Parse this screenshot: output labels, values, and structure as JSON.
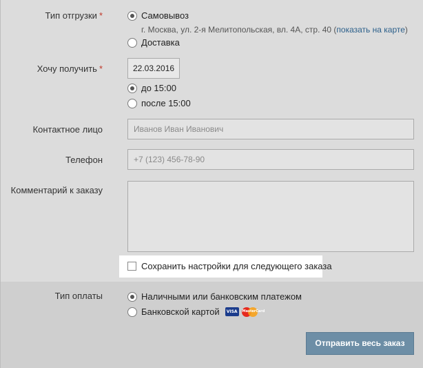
{
  "shipping": {
    "label": "Тип отгрузки",
    "required_mark": "*",
    "options": [
      {
        "label": "Самовывоз",
        "checked": true
      },
      {
        "label": "Доставка",
        "checked": false
      }
    ],
    "address": "г. Москва, ул. 2-я Мелитопольская, вл. 4А, стр. 40 (",
    "map_link": "показать на карте",
    "address_close": ")"
  },
  "receive": {
    "label": "Хочу получить",
    "required_mark": "*",
    "date_value": "22.03.2016",
    "options": [
      {
        "label": "до 15:00",
        "checked": true
      },
      {
        "label": "после 15:00",
        "checked": false
      }
    ]
  },
  "contact": {
    "label": "Контактное лицо",
    "placeholder": "Иванов Иван Иванович"
  },
  "phone": {
    "label": "Телефон",
    "placeholder": "+7 (123) 456-78-90"
  },
  "comment": {
    "label": "Комментарий к заказу",
    "value": ""
  },
  "save_settings": {
    "label": "Сохранить настройки для следующего заказа",
    "checked": false
  },
  "payment": {
    "label": "Тип оплаты",
    "options": [
      {
        "label": "Наличными или банковским платежом",
        "checked": true
      },
      {
        "label": "Банковской картой",
        "checked": false
      }
    ],
    "card_icons": [
      "visa-icon",
      "mastercard-icon"
    ],
    "visa_text": "VISA",
    "mc_text": "MasterCard"
  },
  "submit": {
    "label": "Отправить весь заказ"
  },
  "colors": {
    "accent_button": "#6d8ea6",
    "required": "#c0392b",
    "link": "#2b5f8a"
  }
}
